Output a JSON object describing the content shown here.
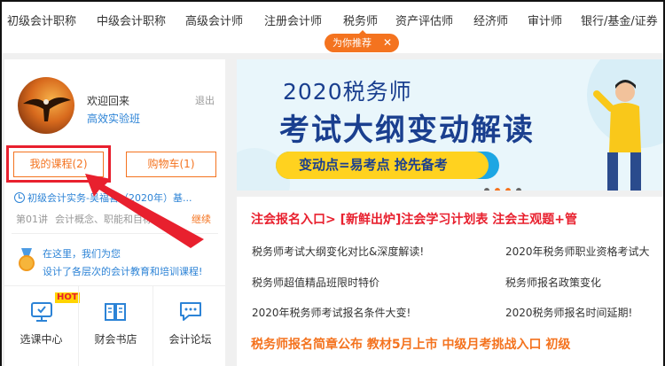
{
  "nav": {
    "items": [
      "初级会计职称",
      "中级会计职称",
      "高级会计师",
      "注册会计师",
      "税务师",
      "资产评估师",
      "经济师",
      "审计师",
      "银行/基金/证券"
    ],
    "recommend_label": "为你推荐",
    "recommend_close": "✕"
  },
  "user": {
    "welcome": "欢迎回来",
    "logout": "退出",
    "class_name": "高效实验班"
  },
  "buttons": {
    "my_courses": "我的课程(2)",
    "cart": "购物车(1)"
  },
  "recent_course": {
    "course": "初级会计实务-吴福喜（2020年）基...",
    "lesson_no": "第01讲",
    "lesson_title": "会计概念、职能和目标",
    "continue": "继续"
  },
  "promo": {
    "line1": "在这里，我们为您",
    "line2": "设计了各层次的会计教育和培训课程!"
  },
  "tiles": [
    {
      "label": "选课中心",
      "icon": "monitor-icon",
      "badge": "HOT"
    },
    {
      "label": "财会书店",
      "icon": "book-icon"
    },
    {
      "label": "会计论坛",
      "icon": "chat-icon"
    }
  ],
  "banner": {
    "year_line": "2020税务师",
    "headline": "考试大纲变动解读",
    "slogan": "变动点=易考点   抢先备考"
  },
  "news": {
    "headline": "注会报名入口>  [新鲜出炉]注会学习计划表  注会主观题+管",
    "links_left": [
      "税务师考试大纲变化对比&深度解读!",
      "税务师超值精品班限时特价",
      "2020年税务师考试报名条件大变!"
    ],
    "links_right": [
      "2020年税务师职业资格考试大",
      "税务师报名政策变化",
      "2020税务师报名时间延期!"
    ],
    "bottom_headline": "税务师报名简章公布  教材5月上市  中级月考挑战入口  初级"
  },
  "colors": {
    "accent": "#f4731f",
    "link": "#2c83d6",
    "highlight": "#e8202e",
    "banner_bg": "#e9f6fb"
  }
}
